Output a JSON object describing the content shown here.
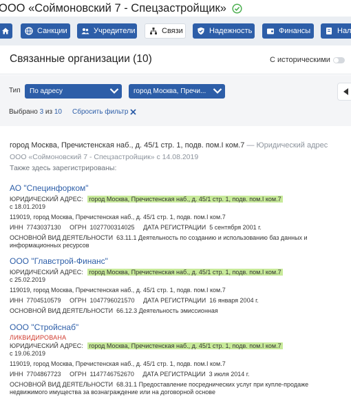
{
  "company_title": "ООО «Соймоновский 7 - Спецзастройщик»",
  "nav": [
    {
      "label": "",
      "icon": "home-icon"
    },
    {
      "label": "Санкции",
      "icon": "globe-icon"
    },
    {
      "label": "Учредители",
      "icon": "users-icon"
    },
    {
      "label": "Связи",
      "icon": "network-icon"
    },
    {
      "label": "Надежность",
      "icon": "shield-check-icon"
    },
    {
      "label": "Финансы",
      "icon": "wallet-icon"
    },
    {
      "label": "Нало",
      "icon": "tax-icon"
    }
  ],
  "section": {
    "title": "Связанные организации (10)",
    "historical_label": "С историческими",
    "historical_enabled": false
  },
  "filters": {
    "type_label": "Тип",
    "type_value": "По адресу",
    "address_value": "город Москва, Пречи...",
    "selected_prefix": "Выбрано",
    "selected_count": "3",
    "selected_of": "из",
    "selected_total": "10",
    "reset_label": "Сбросить фильтр"
  },
  "address_block": {
    "address": "город Москва, Пречистенская наб., д. 45/1 стр. 1, подв. пом.I ком.7",
    "address_type": " — Юридический адрес",
    "registered": "ООО «Соймоновский 7 - Спецзастройщик» с 14.08.2019",
    "also_registered": "Также здесь зарегистрированы:"
  },
  "labels": {
    "legal_address": "Юридический адрес:",
    "inn": "ИНН",
    "ogrn": "ОГРН",
    "reg_date": "Дата регистрации",
    "main_activity": "Основной вид деятельности"
  },
  "orgs": [
    {
      "name": "АО \"Специнфорком\"",
      "status": "",
      "legal_address": "город Москва, Пречистенская наб., д. 45/1 стр. 1, подв. пом.I ком.7",
      "since": "с 18.01.2019",
      "full_address": "119019, город Москва, Пречистенская наб., д. 45/1 стр. 1, подв. пом.I ком.7",
      "inn": "7743037130",
      "ogrn": "1027700314025",
      "reg_date": "5 сентября 2001 г.",
      "activity": "63.11.1 Деятельность по созданию и использованию баз данных и информационных ресурсов"
    },
    {
      "name": "ООО \"Главстрой-Финанс\"",
      "status": "",
      "legal_address": "город Москва, Пречистенская наб., д. 45/1 стр. 1, подв. пом.I ком.7",
      "since": "с 25.02.2019",
      "full_address": "119019, город Москва, Пречистенская наб., д. 45/1 стр. 1, подв. пом.I ком.7",
      "inn": "7704510579",
      "ogrn": "1047796021570",
      "reg_date": "16 января 2004 г.",
      "activity": "66.12.3 Деятельность эмиссионная"
    },
    {
      "name": "ООО \"Стройснаб\"",
      "status": "ЛИКВИДИРОВАНА",
      "legal_address": "город Москва, Пречистенская наб., д. 45/1 стр. 1, подв. пом.I ком.7",
      "since": "с 19.06.2019",
      "full_address": "119019, город Москва, Пречистенская наб., д. 45/1 стр. 1, подв. пом.I ком.7",
      "inn": "7704867723",
      "ogrn": "1147746752670",
      "reg_date": "3 июля 2014 г.",
      "activity": "68.31.1 Предоставление посреднических услуг при купле-продаже недвижимого имущества за вознаграждение или на договорной основе"
    }
  ],
  "colors": {
    "primary": "#2d5ea8",
    "highlight": "#c8ea9a",
    "liquidated": "#d03a2d",
    "verified": "#4caf50"
  }
}
